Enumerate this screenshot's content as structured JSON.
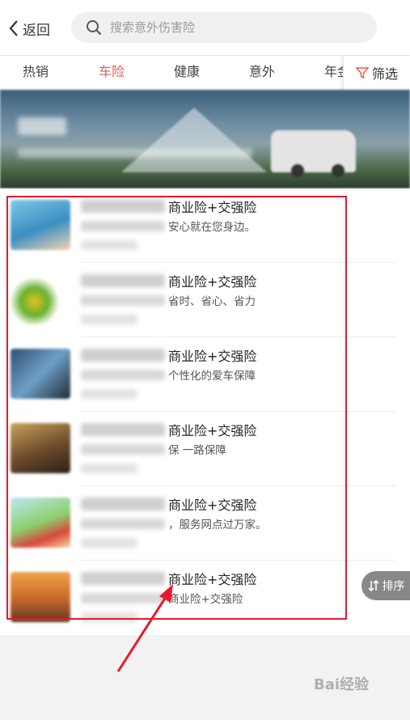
{
  "header": {
    "back_label": "返回",
    "search_placeholder": "搜索意外伤害险"
  },
  "tabs": [
    {
      "label": "热销",
      "active": false
    },
    {
      "label": "车险",
      "active": true
    },
    {
      "label": "健康",
      "active": false
    },
    {
      "label": "意外",
      "active": false
    },
    {
      "label": "年金",
      "active": false
    }
  ],
  "filter": {
    "label": "筛选"
  },
  "products": [
    {
      "title": "商业险+交强险",
      "subtitle": "安心就在您身边。"
    },
    {
      "title": "商业险+交强险",
      "subtitle": "省时、省心、省力"
    },
    {
      "title": "商业险+交强险",
      "subtitle": "个性化的爱车保障"
    },
    {
      "title": "商业险+交强险",
      "subtitle": "保 一路保障"
    },
    {
      "title": "商业险+交强险",
      "subtitle": "，服务网点过万家。"
    },
    {
      "title": "商业险+交强险",
      "subtitle": "商业险+交强险"
    }
  ],
  "sort": {
    "label": "排序"
  },
  "watermark": "Bai经验",
  "colors": {
    "accent": "#e85a4f",
    "annotation_red": "#e8192c"
  }
}
